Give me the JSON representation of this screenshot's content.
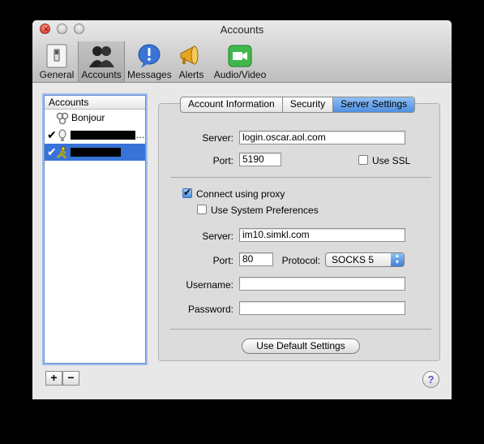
{
  "window": {
    "title": "Accounts"
  },
  "toolbar": {
    "items": [
      {
        "label": "General",
        "icon": "general-switch-icon"
      },
      {
        "label": "Accounts",
        "icon": "people-icon",
        "selected": true
      },
      {
        "label": "Messages",
        "icon": "message-bubble-icon"
      },
      {
        "label": "Alerts",
        "icon": "megaphone-icon"
      },
      {
        "label": "Audio/Video",
        "icon": "video-camera-icon"
      }
    ]
  },
  "accounts": {
    "header": "Accounts",
    "items": [
      {
        "label": "Bonjour",
        "icon": "bonjour-icon",
        "enabled": false
      },
      {
        "label": "",
        "icon": "lightbulb-icon",
        "enabled": true,
        "redacted": true,
        "suffix": "…"
      },
      {
        "label": "",
        "icon": "aim-running-man-icon",
        "enabled": true,
        "redacted": true,
        "selected": true
      }
    ],
    "add_label": "+",
    "remove_label": "−"
  },
  "tabs": [
    {
      "label": "Account Information"
    },
    {
      "label": "Security"
    },
    {
      "label": "Server Settings",
      "selected": true
    }
  ],
  "server": {
    "server_label": "Server:",
    "server_value": "login.oscar.aol.com",
    "port_label": "Port:",
    "port_value": "5190",
    "ssl_label": "Use SSL",
    "ssl_checked": false
  },
  "proxy": {
    "connect_label": "Connect using proxy",
    "connect_checked": true,
    "sysprefs_label": "Use System Preferences",
    "sysprefs_checked": false,
    "server_label": "Server:",
    "server_value": "im10.simkl.com",
    "port_label": "Port:",
    "port_value": "80",
    "protocol_label": "Protocol:",
    "protocol_value": "SOCKS 5",
    "username_label": "Username:",
    "username_value": "",
    "password_label": "Password:",
    "password_value": ""
  },
  "default_button": "Use Default Settings",
  "help_label": "?",
  "colors": {
    "selection": "#3874d8",
    "accent_tab": "#4f8fe0",
    "close_light": "#d8231a"
  }
}
